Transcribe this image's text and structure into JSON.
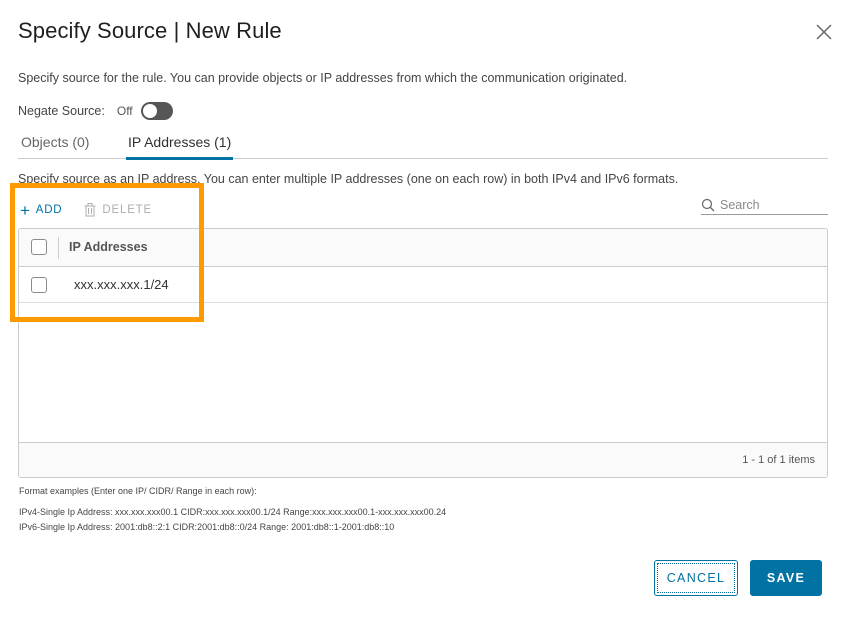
{
  "dialog": {
    "title": "Specify Source | New Rule",
    "description": "Specify source for the rule. You can provide objects or IP addresses from which the communication originated."
  },
  "negate": {
    "label": "Negate Source:",
    "state": "Off",
    "enabled": false
  },
  "tabs": [
    {
      "label": "Objects (0)",
      "active": false
    },
    {
      "label": "IP Addresses (1)",
      "active": true
    }
  ],
  "ip_section": {
    "hint": "Specify source as an IP address. You can enter multiple IP addresses (one on each row) in both IPv4 and IPv6 formats."
  },
  "toolbar": {
    "add_label": "ADD",
    "delete_label": "DELETE"
  },
  "search": {
    "placeholder": "Search"
  },
  "grid": {
    "column_header": "IP Addresses",
    "rows": [
      {
        "ip": "xxx.xxx.xxx.1/24"
      }
    ],
    "pagination": "1 - 1 of 1 items"
  },
  "format_examples": {
    "title": "Format examples (Enter one IP/ CIDR/ Range in each row):",
    "ipv4": "IPv4-Single Ip Address: xxx.xxx.xxx00.1 CIDR:xxx.xxx.xxx00.1/24 Range:xxx.xxx.xxx00.1-xxx.xxx.xxx00.24",
    "ipv6": "IPv6-Single Ip Address: 2001:db8::2:1 CIDR:2001:db8::0/24 Range: 2001:db8::1-2001:db8::10"
  },
  "buttons": {
    "cancel": "CANCEL",
    "save": "SAVE"
  },
  "colors": {
    "accent": "#0072a3",
    "highlight": "#ff9b00"
  }
}
